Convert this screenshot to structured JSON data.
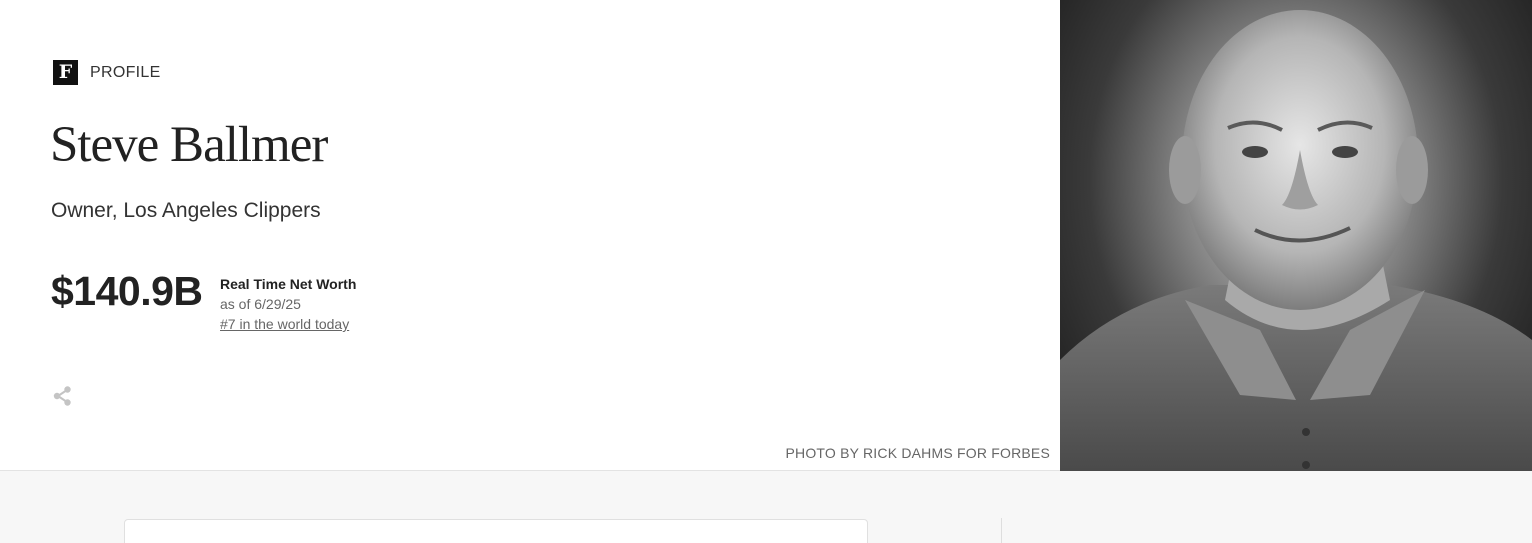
{
  "profile": {
    "brand_letter": "F",
    "section_label": "PROFILE",
    "name": "Steve Ballmer",
    "title": "Owner, Los Angeles Clippers"
  },
  "net_worth": {
    "value": "$140.9B",
    "label": "Real Time Net Worth",
    "as_of": "as of 6/29/25",
    "rank": "#7 in the world today"
  },
  "photo": {
    "credit": "PHOTO BY RICK DAHMS FOR FORBES"
  },
  "icons": {
    "brand": "forbes-f-logo-icon",
    "share": "share-icon"
  },
  "colors": {
    "text_primary": "#222222",
    "text_secondary": "#666666",
    "share_icon": "#c4c4c4",
    "lower_background": "#f7f7f7"
  }
}
